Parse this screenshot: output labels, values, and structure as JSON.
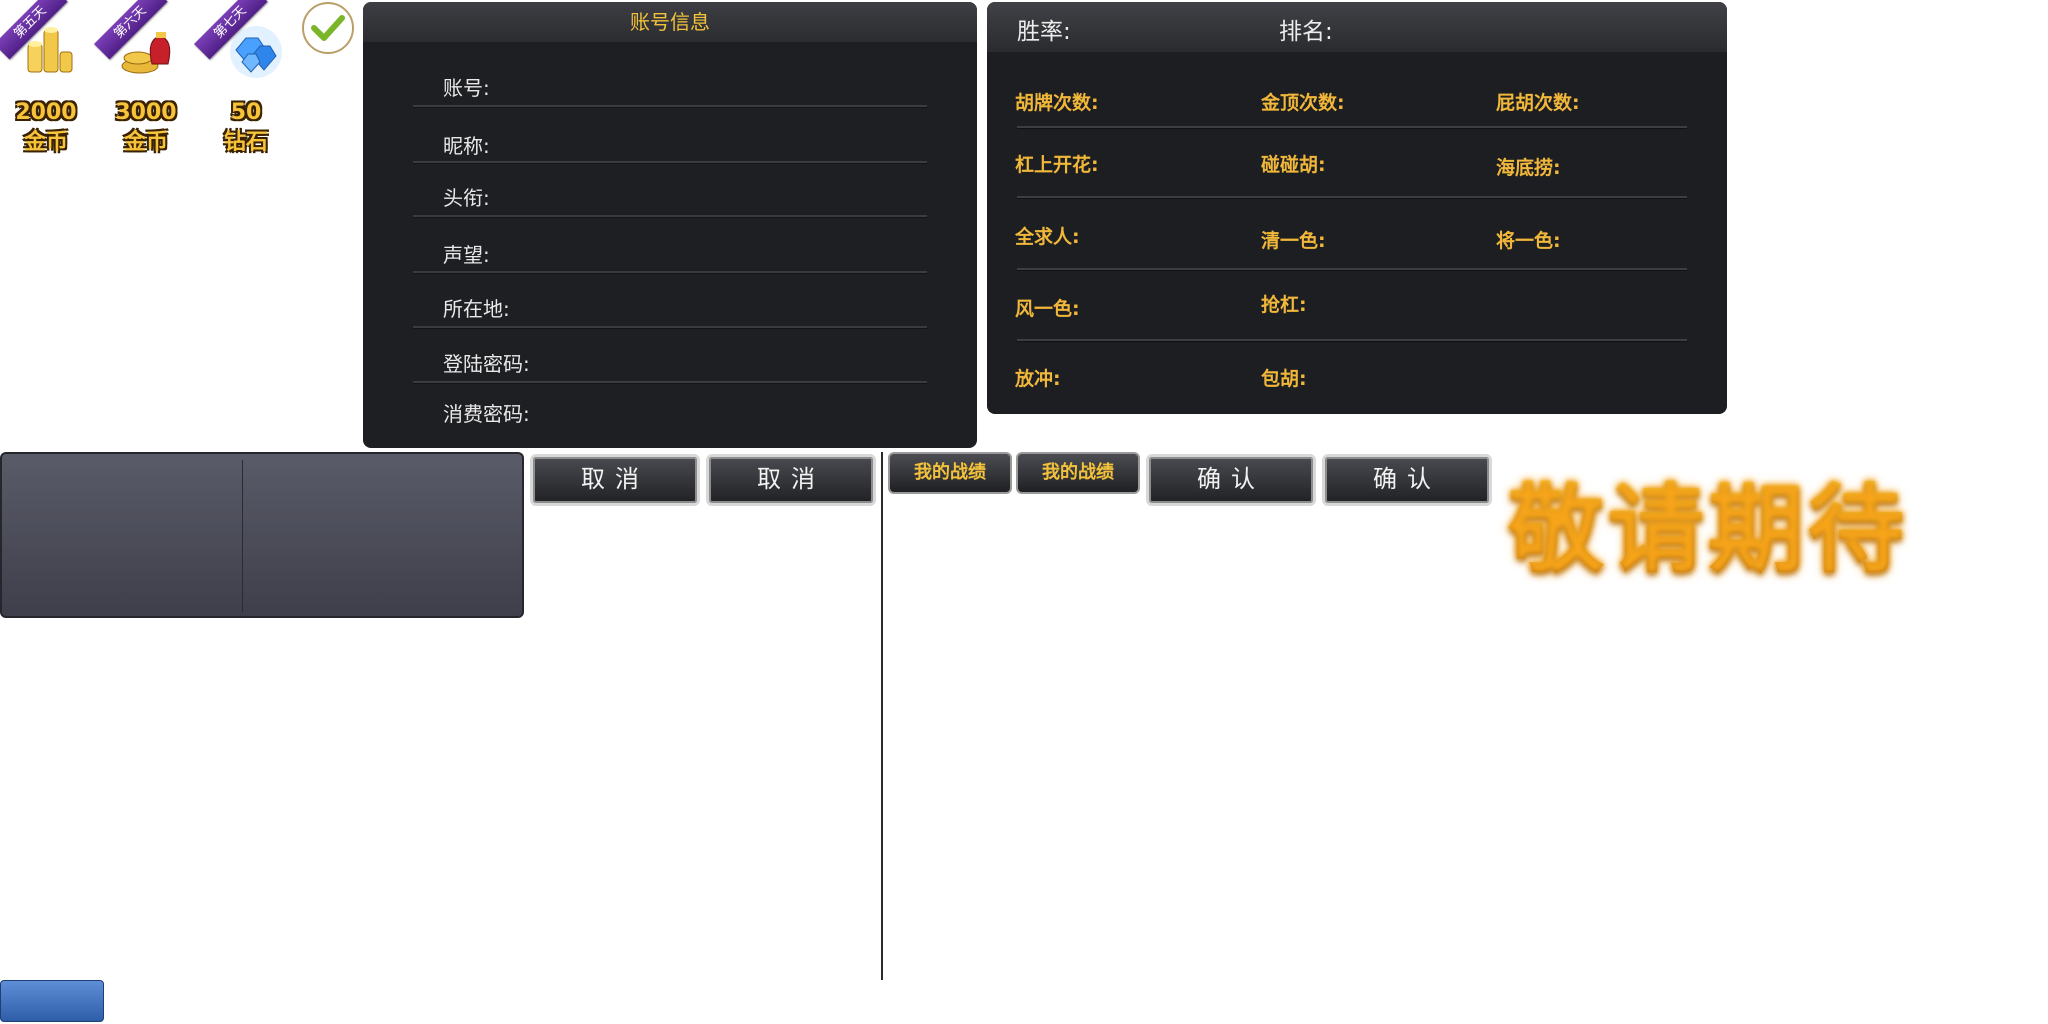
{
  "rewards": [
    {
      "day": "第五天",
      "amount": "2000",
      "unit": "金币",
      "icon": "gold-coins-icon"
    },
    {
      "day": "第六天",
      "amount": "3000",
      "unit": "金币",
      "icon": "coin-bag-icon"
    },
    {
      "day": "第七天",
      "amount": "50",
      "unit": "钻石",
      "icon": "diamonds-icon"
    }
  ],
  "account_panel": {
    "title": "账号信息",
    "fields": [
      "账号:",
      "昵称:",
      "头衔:",
      "声望:",
      "所在地:",
      "登陆密码:",
      "消费密码:"
    ]
  },
  "stats_panel": {
    "win_rate_label": "胜率:",
    "rank_label": "排名:",
    "stats": [
      [
        "胡牌次数:",
        "金顶次数:",
        "屁胡次数:"
      ],
      [
        "杠上开花:",
        "碰碰胡:",
        "海底捞:"
      ],
      [
        "全求人:",
        "清一色:",
        "将一色:"
      ],
      [
        "风一色:",
        "抢杠:"
      ],
      [
        "放冲:",
        "包胡:"
      ]
    ]
  },
  "buttons": {
    "cancel_1": "取消",
    "cancel_2": "取消",
    "record_1": "我的战绩",
    "record_2": "我的战绩",
    "confirm_1": "确认",
    "confirm_2": "确认"
  },
  "coming_soon": "敬请期待",
  "colors": {
    "gold_text": "#f3c23a",
    "panel_bg": "#1e1f22",
    "blue_button": "#3b6bb8"
  }
}
